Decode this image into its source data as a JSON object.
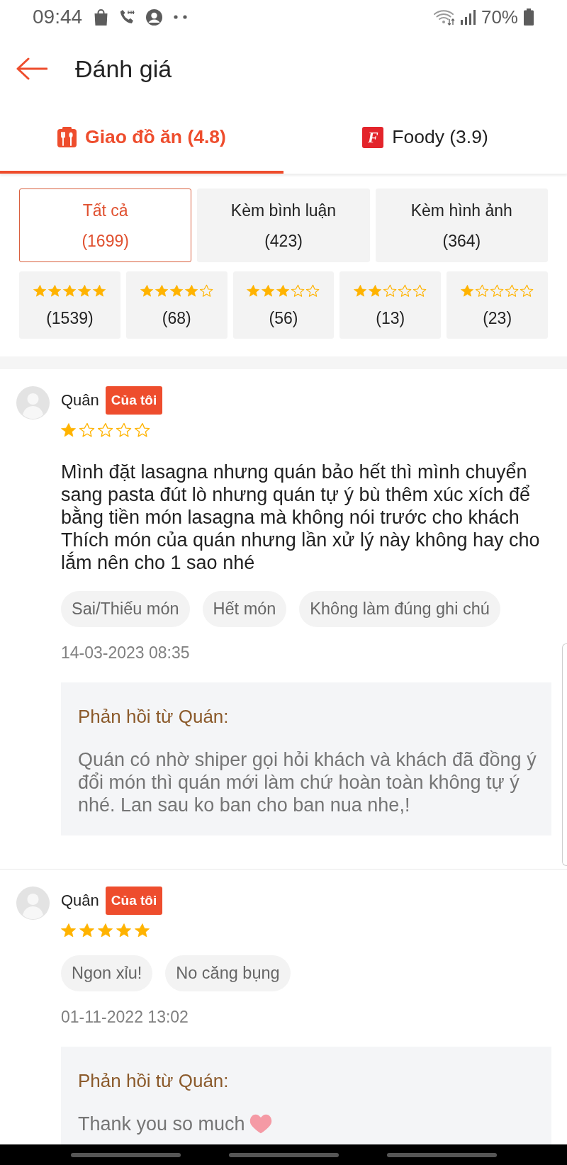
{
  "status_bar": {
    "time": "09:44",
    "battery": "70%"
  },
  "header": {
    "title": "Đánh giá"
  },
  "tabs": [
    {
      "kind": "delivery",
      "label": "Giao đồ ăn (4.8)",
      "selected": true
    },
    {
      "kind": "logo",
      "logo_text": "F",
      "label": "Foody (3.9)",
      "selected": false
    }
  ],
  "filters": [
    {
      "label": "Tất cả",
      "count": "(1699)",
      "selected": true
    },
    {
      "label": "Kèm bình luận",
      "count": "(423)",
      "selected": false
    },
    {
      "label": "Kèm hình ảnh",
      "count": "(364)",
      "selected": false
    }
  ],
  "star_filters": [
    {
      "stars": 5,
      "count": "(1539)",
      "selected": false
    },
    {
      "stars": 4,
      "count": "(68)",
      "selected": false
    },
    {
      "stars": 3,
      "count": "(56)",
      "selected": false
    },
    {
      "stars": 2,
      "count": "(13)",
      "selected": false
    },
    {
      "stars": 1,
      "count": "(23)",
      "selected": false
    }
  ],
  "reviews": [
    {
      "author": "Quân",
      "badge": "Của tôi",
      "stars": 1,
      "text": "Mình đặt lasagna nhưng quán bảo hết thì mình chuyển sang pasta đút lò nhưng quán tự ý bù thêm xúc xích để bằng tiền món lasagna mà không nói trước cho khách\nThích món của quán nhưng lần xử lý này không hay cho lắm nên cho 1 sao nhé",
      "tags": [
        "Sai/Thiếu món",
        "Hết món",
        "Không làm đúng ghi chú"
      ],
      "date": "14-03-2023 08:35",
      "reply": {
        "kind": "text",
        "title": "Phản hồi từ Quán:",
        "text": "Quán có nhờ shiper gọi hỏi khách và khách đã đồng ý đổi món thì quán mới làm chứ hoàn toàn không tự ý nhé. Lan sau ko ban cho ban nua nhe,!"
      }
    },
    {
      "author": "Quân",
      "badge": "Của tôi",
      "stars": 5,
      "tags": [
        "Ngon xỉu!",
        "No căng bụng"
      ],
      "date": "01-11-2022 13:02",
      "reply": {
        "kind": "text_with_emoji",
        "title": "Phản hồi từ Quán:",
        "text": "Thank you so much"
      }
    }
  ]
}
